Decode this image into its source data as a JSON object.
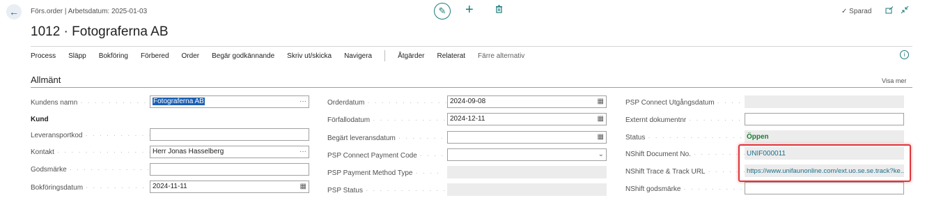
{
  "header": {
    "breadcrumb": "Förs.order | Arbetsdatum: 2025-01-03",
    "title": "1012 · Fotograferna AB",
    "saved_label": "Sparad"
  },
  "actions": [
    "Process",
    "Släpp",
    "Bokföring",
    "Förbered",
    "Order",
    "Begär godkännande",
    "Skriv ut/skicka",
    "Navigera"
  ],
  "actions_after": [
    "Åtgärder",
    "Relaterat"
  ],
  "fewer_options": "Färre alternativ",
  "section": {
    "title": "Allmänt",
    "show_more": "Visa mer"
  },
  "col1": {
    "customer_name_label": "Kundens namn",
    "customer_name_value": "Fotograferna AB",
    "customer_group": "Kund",
    "ship_code_label": "Leveransportkod",
    "ship_code_value": "",
    "contact_label": "Kontakt",
    "contact_value": "Herr Jonas Hasselberg",
    "goods_mark_label": "Godsmärke",
    "goods_mark_value": "",
    "posting_date_label": "Bokföringsdatum",
    "posting_date_value": "2024-11-11"
  },
  "col2": {
    "order_date_label": "Orderdatum",
    "order_date_value": "2024-09-08",
    "due_date_label": "Förfallodatum",
    "due_date_value": "2024-12-11",
    "req_delivery_label": "Begärt leveransdatum",
    "req_delivery_value": "",
    "psp_payment_code_label": "PSP Connect Payment Code",
    "psp_payment_code_value": "",
    "psp_method_type_label": "PSP Payment Method Type",
    "psp_status_label": "PSP Status"
  },
  "col3": {
    "psp_expiry_label": "PSP Connect Utgångsdatum",
    "ext_doc_label": "Externt dokumentnr",
    "ext_doc_value": "",
    "status_label": "Status",
    "status_value": "Öppen",
    "nshift_doc_label": "NShift Document No.",
    "nshift_doc_value": "UNIF000011",
    "nshift_url_label": "NShift Trace & Track URL",
    "nshift_url_value": "https://www.unifaunonline.com/ext.uo.se.se.track?ke...",
    "nshift_mark_label": "NShift godsmärke",
    "nshift_mark_value": ""
  },
  "icons": {
    "back": "arrow-left-icon",
    "edit": "pencil-icon",
    "new": "plus-icon",
    "delete": "trash-icon",
    "saved": "check-icon",
    "popout": "open-new-window-icon",
    "collapse": "collapse-icon",
    "info": "info-icon",
    "calendar": "calendar-icon",
    "more": "ellipsis-icon",
    "dropdown": "chevron-down-icon"
  },
  "colors": {
    "accent": "#1b7a7a",
    "highlight": "#e0353a",
    "status_open": "#1e7d32",
    "selection": "#1a5fb4"
  }
}
